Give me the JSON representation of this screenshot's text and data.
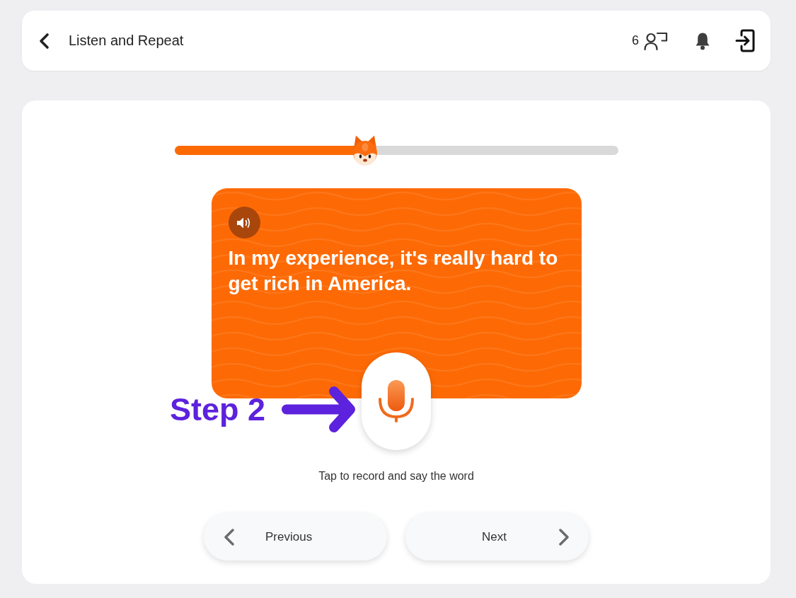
{
  "header": {
    "title": "Listen and Repeat",
    "count": "6"
  },
  "progress": {
    "level": 0.43
  },
  "phrase_card": {
    "text": "In my experience, it's really hard to get rich in America."
  },
  "annotation": {
    "label": "Step 2"
  },
  "record": {
    "hint": "Tap to record and say the word"
  },
  "navigation": [
    {
      "label": "Previous",
      "kind": "previous"
    },
    {
      "label": "Next",
      "kind": "next"
    }
  ]
}
